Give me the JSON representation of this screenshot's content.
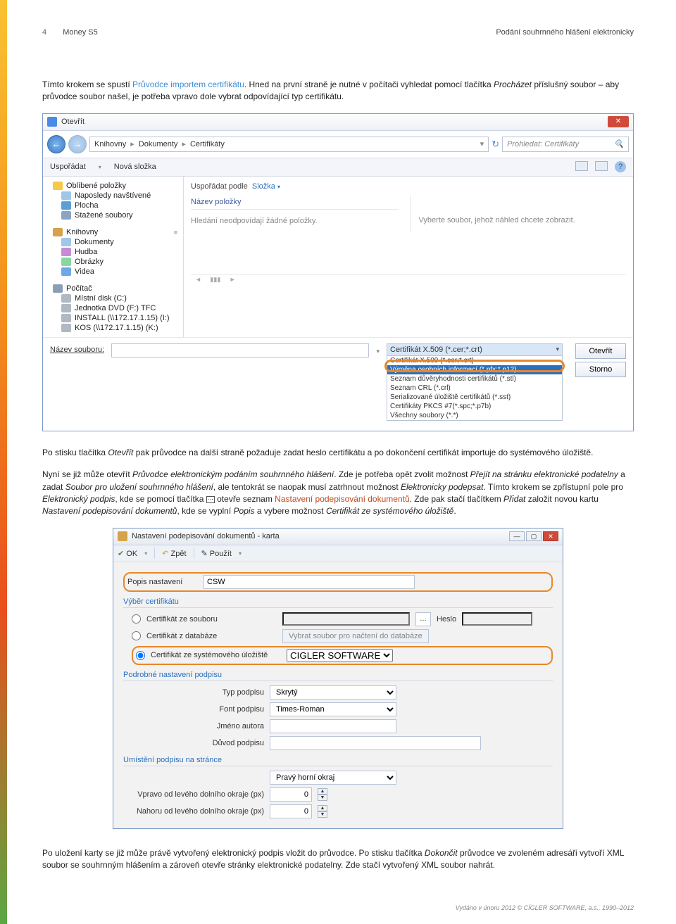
{
  "header": {
    "page": "4",
    "left": "Money S5",
    "right": "Podání souhrnného hlášení elektronicky"
  },
  "p1_a": "Tímto krokem se spustí ",
  "p1_link": "Průvodce importem certifikátu",
  "p1_b": ". Hned na první straně je nutné v počítači vyhledat pomocí tlačítka ",
  "p1_ital": "Procházet",
  "p1_c": " příslušný soubor – aby průvodce soubor našel, je potřeba vpravo dole vybrat odpovídající typ certifikátu.",
  "d1": {
    "title": "Otevřít",
    "crumbs": [
      "Knihovny",
      "Dokumenty",
      "Certifikáty"
    ],
    "search_ph": "Prohledat: Certifikáty",
    "toolbar": {
      "organise": "Uspořádat",
      "newfolder": "Nová složka"
    },
    "tree_groups": {
      "fav": "Oblíbené položky",
      "fav_items": [
        "Naposledy navštívené",
        "Plocha",
        "Stažené soubory"
      ],
      "lib": "Knihovny",
      "lib_items": [
        "Dokumenty",
        "Hudba",
        "Obrázky",
        "Videa"
      ],
      "comp": "Počítač",
      "comp_items": [
        "Místní disk (C:)",
        "Jednotka DVD (F:) TFC",
        "INSTALL (\\\\172.17.1.15) (I:)",
        "KOS (\\\\172.17.1.15) (K:)"
      ]
    },
    "content": {
      "arrange_label": "Uspořádat podle",
      "arrange_value": "Složka",
      "col": "Název položky",
      "empty": "Hledání neodpovídají žádné položky.",
      "preview": "Vyberte soubor, jehož náhled chcete zobrazit."
    },
    "bottom": {
      "fname_label": "Název souboru:",
      "type_options": [
        "Certifikát X.509 (*.cer;*.crt)",
        "Certifikát X.509 (*.cer;*.crt)",
        "Výměna osobních informací (*.pfx;*.p12)",
        "Seznam důvěryhodnosti certifikátů (*.stl)",
        "Seznam CRL (*.crl)",
        "Serializované úložiště certifikátů (*.sst)",
        "Certifikáty PKCS #7(*.spc;*.p7b)",
        "Všechny soubory (*.*)"
      ],
      "open_btn": "Otevřít",
      "cancel_btn": "Storno"
    }
  },
  "p2_a": "Po stisku tlačítka ",
  "p2_i1": "Otevřít",
  "p2_b": " pak průvodce na další straně požaduje zadat heslo certifikátu a po dokončení certifikát importuje do systémového úložiště.",
  "p3_a": "Nyní se již může otevřít ",
  "p3_i1": "Průvodce elektronickým podáním souhrnného hlášení",
  "p3_b": ". Zde je potřeba opět zvolit možnost ",
  "p3_i2": "Přejít na stránku elektronické podatelny",
  "p3_c": " a zadat ",
  "p3_i3": "Soubor pro uložení souhrnného hlášení",
  "p3_d": ", ale tentokrát se naopak musí zatrhnout možnost ",
  "p3_i4": "Elektronicky podepsat",
  "p3_e": ". Tímto krokem se zpřístupní pole pro ",
  "p3_i5": "Elektronický podpis",
  "p3_f": ", kde se pomocí tlačítka ",
  "p3_icon": "⋯",
  "p3_g": " otevře seznam ",
  "p3_hl1": "Nastavení podepisování dokumentů",
  "p3_h": ". Zde pak stačí tlačítkem ",
  "p3_i6": "Přidat",
  "p3_i": " založit novou kartu ",
  "p3_i7": "Nastavení podepisování dokumentů",
  "p3_j": ", kde se vyplní ",
  "p3_i8": "Popis",
  "p3_k": " a vybere možnost ",
  "p3_i9": "Certifikát ze systémového úložiště",
  "p3_l": ".",
  "d2": {
    "title": "Nastavení podepisování dokumentů - karta",
    "tool": {
      "ok": "OK",
      "back": "Zpět",
      "use": "Použít"
    },
    "popis_label": "Popis nastavení",
    "popis_value": "CSW",
    "sec1": "Výběr certifikátu",
    "r1": "Certifikát ze souboru",
    "r1_pw": "Heslo",
    "r2": "Certifikát z databáze",
    "r2_btn": "Vybrat soubor pro načtení do databáze",
    "r3": "Certifikát ze systémového úložiště",
    "r3_val": "CIGLER SOFTWARE",
    "sec2": "Podrobné nastavení podpisu",
    "typ": "Typ podpisu",
    "typ_v": "Skrytý",
    "font": "Font podpisu",
    "font_v": "Times-Roman",
    "autor": "Jméno autora",
    "duvod": "Důvod podpisu",
    "sec3": "Umístění podpisu na stránce",
    "pos": "Pravý horní okraj",
    "vp": "Vpravo od levého dolního okraje (px)",
    "vp_v": "0",
    "nh": "Nahoru od levého dolního okraje (px)",
    "nh_v": "0"
  },
  "p4_a": "Po uložení karty se již může právě vytvořený elektronický podpis vložit do průvodce. Po stisku tlačítka ",
  "p4_i1": "Dokončit",
  "p4_b": " průvodce ve zvoleném adresáři vytvoří XML soubor se souhrnným hlášením a zároveň otevře stránky elektronické podatelny. Zde stačí vytvořený XML soubor nahrát.",
  "footer": "Vydáno v únoru 2012 © CÍGLER SOFTWARE, a.s., 1990–2012"
}
